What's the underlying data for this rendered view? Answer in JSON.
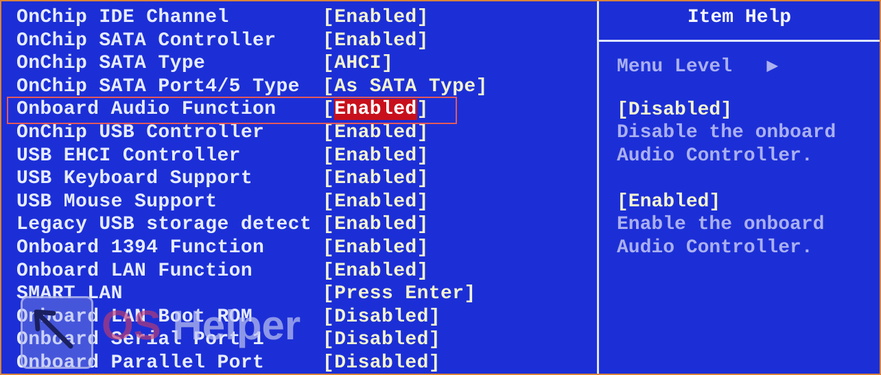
{
  "settings": [
    {
      "label": "OnChip IDE Channel",
      "value": "[Enabled]"
    },
    {
      "label": "OnChip SATA Controller",
      "value": "[Enabled]"
    },
    {
      "label": "OnChip SATA Type",
      "value": "[AHCI]"
    },
    {
      "label": "OnChip SATA Port4/5 Type",
      "value": "[As SATA Type]"
    },
    {
      "label": "Onboard Audio Function",
      "value": "Enabled",
      "selected": true
    },
    {
      "label": "OnChip USB Controller",
      "value": "[Enabled]"
    },
    {
      "label": "USB EHCI Controller",
      "value": "[Enabled]"
    },
    {
      "label": "USB Keyboard Support",
      "value": "[Enabled]"
    },
    {
      "label": "USB Mouse Support",
      "value": "[Enabled]"
    },
    {
      "label": "Legacy USB storage detect",
      "value": "[Enabled]"
    },
    {
      "label": "Onboard 1394 Function",
      "value": "[Enabled]"
    },
    {
      "label": "Onboard LAN Function",
      "value": "[Enabled]"
    },
    {
      "label": "SMART LAN",
      "value": "[Press Enter]"
    },
    {
      "label": "Onboard LAN Boot ROM",
      "value": "[Disabled]"
    },
    {
      "label": "Onboard Serial Port 1",
      "value": "[Disabled]"
    },
    {
      "label": "Onboard Parallel Port",
      "value": "[Disabled]"
    }
  ],
  "help": {
    "title": "Item Help",
    "menu_level": "Menu Level   ▶",
    "opt1": "[Disabled]",
    "opt1_desc1": "Disable the onboard",
    "opt1_desc2": "Audio Controller.",
    "opt2": "[Enabled]",
    "opt2_desc1": "Enable the onboard",
    "opt2_desc2": "Audio Controller."
  },
  "watermark": {
    "os": "OS",
    "helper": " Helper"
  },
  "colors": {
    "background": "#1c2fd6",
    "selection": "#c8101c",
    "highlight_frame": "#e55a5a",
    "border": "#d9833a"
  }
}
